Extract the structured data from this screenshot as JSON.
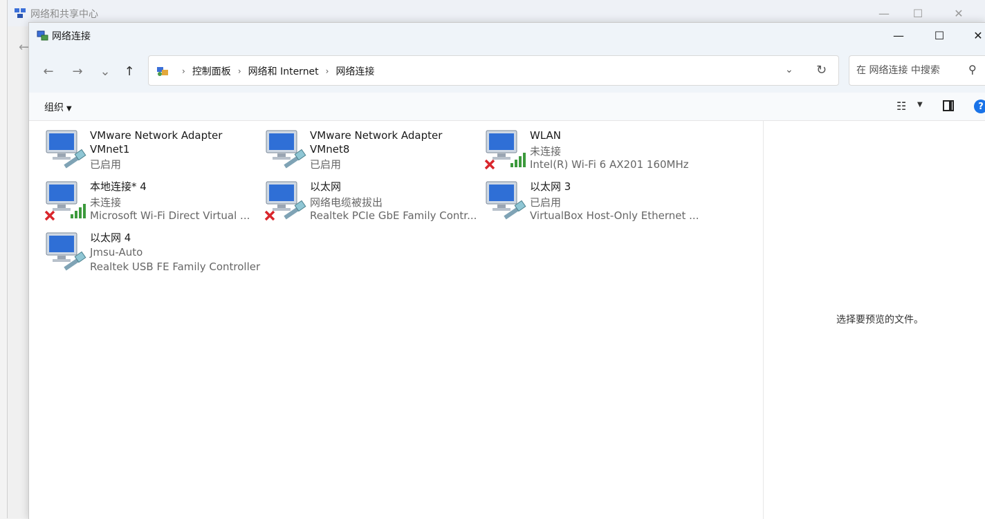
{
  "background_window": {
    "title": "网络和共享中心"
  },
  "window": {
    "title": "网络连接",
    "minimize": "—",
    "maximize": "☐",
    "close": "✕"
  },
  "nav": {
    "back": "←",
    "forward": "→",
    "recent": "⌄",
    "up": "↑",
    "breadcrumbs": [
      "控制面板",
      "网络和 Internet",
      "网络连接"
    ],
    "separator": "›",
    "dropdown": "⌄",
    "refresh": "↻"
  },
  "search": {
    "placeholder": "在 网络连接 中搜索"
  },
  "commands": {
    "organize": "组织"
  },
  "connections": [
    {
      "name": "VMware Network Adapter VMnet1",
      "status": "已启用",
      "device": "",
      "icon": "wired-adapter-icon"
    },
    {
      "name": "VMware Network Adapter VMnet8",
      "status": "已启用",
      "device": "",
      "icon": "wired-adapter-icon"
    },
    {
      "name": "WLAN",
      "status": "未连接",
      "device": "Intel(R) Wi-Fi 6 AX201 160MHz",
      "icon": "wifi-disconnected-icon"
    },
    {
      "name": "本地连接* 4",
      "status": "未连接",
      "device": "Microsoft Wi-Fi Direct Virtual ...",
      "icon": "wifi-disconnected-icon"
    },
    {
      "name": "以太网",
      "status": "网络电缆被拔出",
      "device": "Realtek PCIe GbE Family Contr...",
      "icon": "wired-disconnected-icon"
    },
    {
      "name": "以太网 3",
      "status": "已启用",
      "device": "VirtualBox Host-Only Ethernet ...",
      "icon": "wired-adapter-icon"
    },
    {
      "name": "以太网 4",
      "status": "Jmsu-Auto",
      "device": "Realtek USB FE Family Controller",
      "icon": "wired-adapter-icon"
    }
  ],
  "preview": {
    "empty_text": "选择要预览的文件。"
  },
  "colors": {
    "accent": "#1a73e8",
    "error_red": "#d9262c",
    "signal_green": "#3c9a3c"
  }
}
